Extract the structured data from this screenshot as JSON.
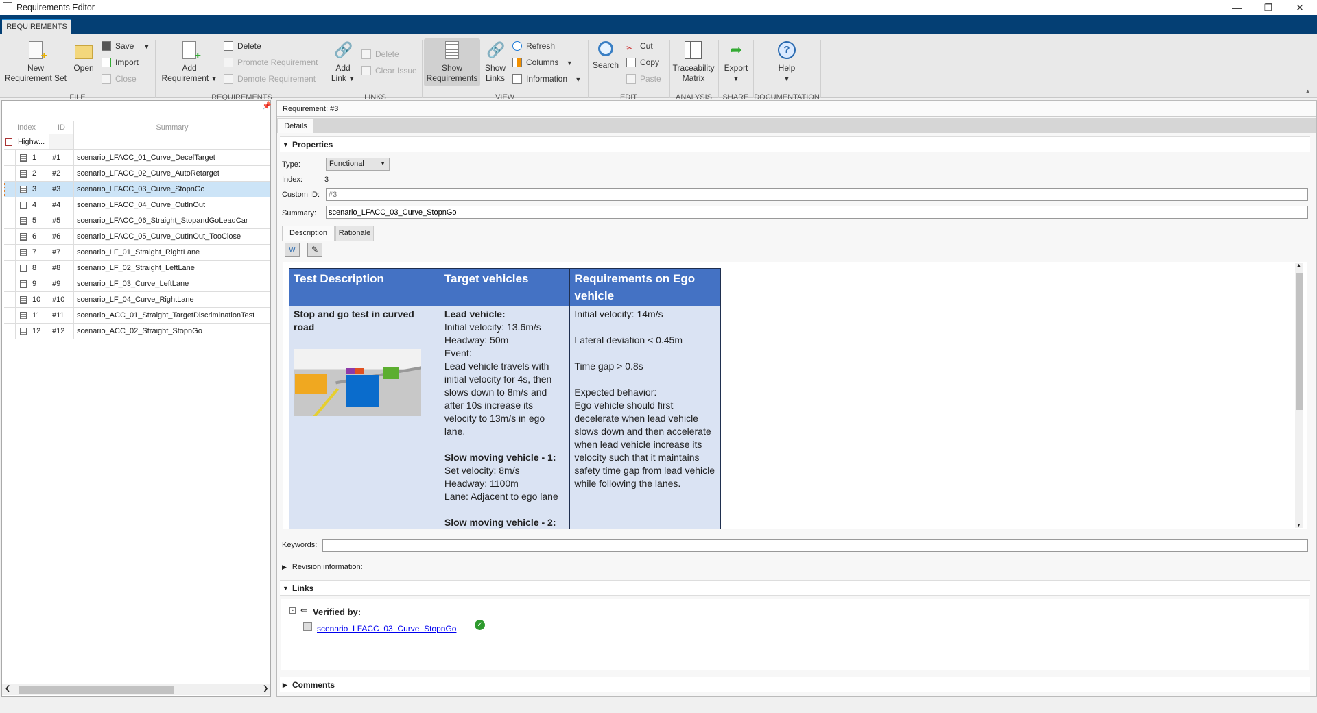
{
  "window": {
    "title": "Requirements Editor",
    "controls": [
      "minimize",
      "restore",
      "close"
    ]
  },
  "ribbon": {
    "tab": "REQUIREMENTS",
    "file": {
      "label": "FILE",
      "new_set": "New\nRequirement Set",
      "open": "Open",
      "save": "Save",
      "import": "Import",
      "close": "Close"
    },
    "requirements": {
      "label": "REQUIREMENTS",
      "add": "Add\nRequirement",
      "delete": "Delete",
      "promote": "Promote Requirement",
      "demote": "Demote Requirement"
    },
    "links": {
      "label": "LINKS",
      "add": "Add\nLink",
      "delete": "Delete",
      "clear_issue": "Clear Issue"
    },
    "view": {
      "label": "VIEW",
      "show_requirements": "Show\nRequirements",
      "show_links": "Show\nLinks",
      "refresh": "Refresh",
      "columns": "Columns",
      "information": "Information"
    },
    "edit": {
      "label": "EDIT",
      "search": "Search",
      "cut": "Cut",
      "copy": "Copy",
      "paste": "Paste"
    },
    "analysis": {
      "label": "ANALYSIS",
      "traceability": "Traceability\nMatrix"
    },
    "share": {
      "label": "SHARE",
      "export": "Export"
    },
    "documentation": {
      "label": "DOCUMENTATION",
      "help": "Help"
    }
  },
  "tree": {
    "columns": [
      "Index",
      "ID",
      "Summary"
    ],
    "root": "Highw...",
    "rows": [
      {
        "index": "1",
        "id": "#1",
        "summary": "scenario_LFACC_01_Curve_DecelTarget"
      },
      {
        "index": "2",
        "id": "#2",
        "summary": "scenario_LFACC_02_Curve_AutoRetarget"
      },
      {
        "index": "3",
        "id": "#3",
        "summary": "scenario_LFACC_03_Curve_StopnGo",
        "selected": true
      },
      {
        "index": "4",
        "id": "#4",
        "summary": "scenario_LFACC_04_Curve_CutInOut"
      },
      {
        "index": "5",
        "id": "#5",
        "summary": "scenario_LFACC_06_Straight_StopandGoLeadCar"
      },
      {
        "index": "6",
        "id": "#6",
        "summary": "scenario_LFACC_05_Curve_CutInOut_TooClose"
      },
      {
        "index": "7",
        "id": "#7",
        "summary": "scenario_LF_01_Straight_RightLane"
      },
      {
        "index": "8",
        "id": "#8",
        "summary": "scenario_LF_02_Straight_LeftLane"
      },
      {
        "index": "9",
        "id": "#9",
        "summary": "scenario_LF_03_Curve_LeftLane"
      },
      {
        "index": "10",
        "id": "#10",
        "summary": "scenario_LF_04_Curve_RightLane"
      },
      {
        "index": "11",
        "id": "#11",
        "summary": "scenario_ACC_01_Straight_TargetDiscriminationTest"
      },
      {
        "index": "12",
        "id": "#12",
        "summary": "scenario_ACC_02_Straight_StopnGo"
      }
    ]
  },
  "details": {
    "header": "Requirement: #3",
    "tab": "Details",
    "properties": {
      "title": "Properties",
      "type_label": "Type:",
      "type_value": "Functional",
      "index_label": "Index:",
      "index_value": "3",
      "custom_id_label": "Custom ID:",
      "custom_id_placeholder": "#3",
      "summary_label": "Summary:",
      "summary_value": "scenario_LFACC_03_Curve_StopnGo"
    },
    "subtabs": [
      "Description",
      "Rationale"
    ],
    "description_table": {
      "headers": [
        "Test Description",
        "Target vehicles",
        "Requirements on Ego vehicle"
      ],
      "col1": "Stop and go test in curved road",
      "col2": {
        "lead_title": "Lead vehicle:",
        "lead_lines": "Initial velocity: 13.6m/s\nHeadway: 50m\nEvent:\nLead vehicle travels with initial velocity for 4s, then slows down to 8m/s and after 10s increase its velocity to 13m/s in ego lane.",
        "slow1_title": "Slow moving vehicle - 1:",
        "slow1_lines": "Set velocity: 8m/s\nHeadway: 1100m\nLane: Adjacent to ego lane",
        "slow2_title": "Slow moving vehicle - 2:"
      },
      "col3": "Initial velocity: 14m/s\n\nLateral deviation < 0.45m\n\nTime gap > 0.8s\n\nExpected behavior:\nEgo vehicle should first decelerate when lead vehicle slows down and then accelerate when lead vehicle increase its velocity such that it maintains safety time gap from lead vehicle while following the lanes."
    },
    "keywords_label": "Keywords:",
    "keywords_value": "",
    "revision_label": "Revision information:",
    "links": {
      "title": "Links",
      "verified_by": "Verified by:",
      "item": "scenario_LFACC_03_Curve_StopnGo",
      "status": "verified"
    },
    "comments": "Comments"
  },
  "colors": {
    "ribbon_band": "#043f74",
    "table_header": "#4472c4",
    "table_body": "#dae3f3",
    "selection": "#cce4f7",
    "link": "#0000ee"
  }
}
